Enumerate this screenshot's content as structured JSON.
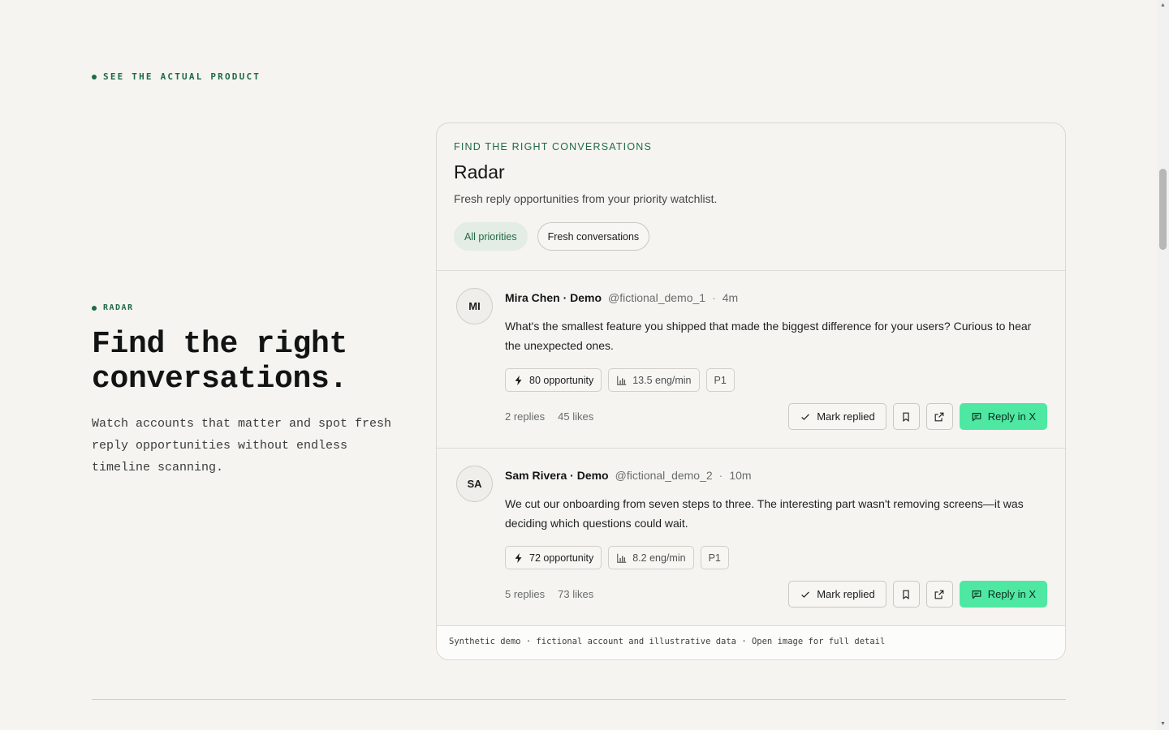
{
  "section": {
    "eyebrow": "SEE THE ACTUAL PRODUCT"
  },
  "intro": {
    "eyebrow": "RADAR",
    "title": "Find the right conversations.",
    "description": "Watch accounts that matter and spot fresh reply opportunities without endless timeline scanning."
  },
  "card": {
    "kicker": "FIND THE RIGHT CONVERSATIONS",
    "title": "Radar",
    "subtitle": "Fresh reply opportunities from your priority watchlist.",
    "chips": [
      "All priorities",
      "Fresh conversations"
    ],
    "footer": "Synthetic demo · fictional account and illustrative data · Open image for full detail"
  },
  "actions": {
    "mark_replied": "Mark replied",
    "reply": "Reply in X"
  },
  "posts": [
    {
      "initials": "MI",
      "name": "Mira Chen · Demo",
      "handle": "@fictional_demo_1",
      "time": "4m",
      "text": "What's the smallest feature you shipped that made the biggest difference for your users? Curious to hear the unexpected ones.",
      "opportunity": "80 opportunity",
      "engagement": "13.5 eng/min",
      "priority": "P1",
      "replies": "2 replies",
      "likes": "45 likes"
    },
    {
      "initials": "SA",
      "name": "Sam Rivera · Demo",
      "handle": "@fictional_demo_2",
      "time": "10m",
      "text": "We cut our onboarding from seven steps to three. The interesting part wasn't removing screens—it was deciding which questions could wait.",
      "opportunity": "72 opportunity",
      "engagement": "8.2 eng/min",
      "priority": "P1",
      "replies": "5 replies",
      "likes": "73 likes"
    }
  ],
  "colors": {
    "accent": "#1f6a43",
    "primary_button": "#4ee8a3",
    "background": "#f5f4f1"
  }
}
